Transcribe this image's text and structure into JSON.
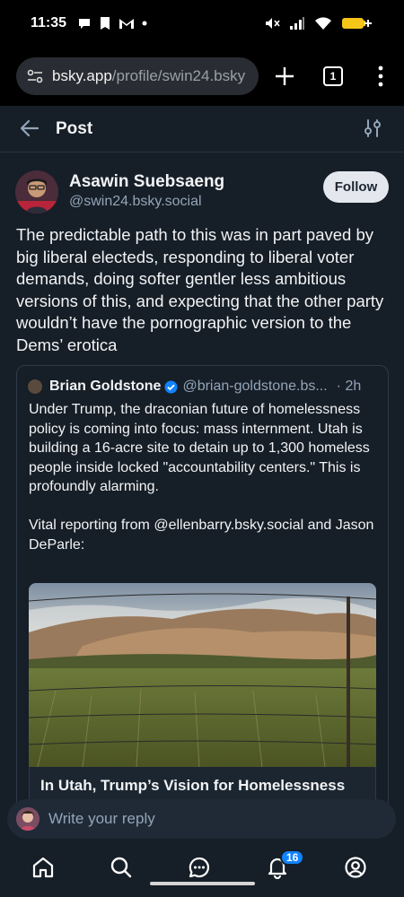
{
  "status_bar": {
    "time": "11:35",
    "icons": [
      "chat-bubble-icon",
      "bookmark-icon",
      "gmail-icon",
      "dot-icon",
      "mute-icon",
      "signal-icon",
      "wifi-icon",
      "battery-icon"
    ],
    "battery_color": "#f5c518"
  },
  "browser": {
    "url_host": "bsky.app",
    "url_path": "/profile/swin24.bsky",
    "tab_count": "1"
  },
  "header": {
    "title": "Post"
  },
  "post": {
    "author_name": "Asawin Suebsaeng",
    "author_handle": "@swin24.bsky.social",
    "follow_label": "Follow",
    "text": "The predictable path to this was in part paved by big liberal electeds, responding to liberal voter demands, doing softer gentler less ambitious versions of this, and expecting that the other party wouldn’t have the pornographic version to the Dems’ erotica"
  },
  "quote": {
    "author_name": "Brian Goldstone",
    "author_handle": "@brian-goldstone.bs...",
    "time": "· 2h",
    "text": "Under Trump, the draconian future of homelessness policy is coming into focus: mass internment. Utah is building a 16-acre site to detain up to 1,300 homeless people inside locked \"accountability centers.\" This is profoundly alarming.\n\nVital reporting from @ellenbarry.bsky.social and Jason DeParle:",
    "link_title": "In Utah, Trump’s Vision for Homelessness Begins to Take Shape"
  },
  "reply": {
    "placeholder": "Write your reply"
  },
  "nav": {
    "items": [
      "home-icon",
      "search-icon",
      "chat-icon",
      "notifications-icon",
      "profile-icon"
    ],
    "notification_count": "16"
  },
  "colors": {
    "background": "#161e27",
    "accent": "#1083fe",
    "muted_text": "#93a5b8"
  }
}
